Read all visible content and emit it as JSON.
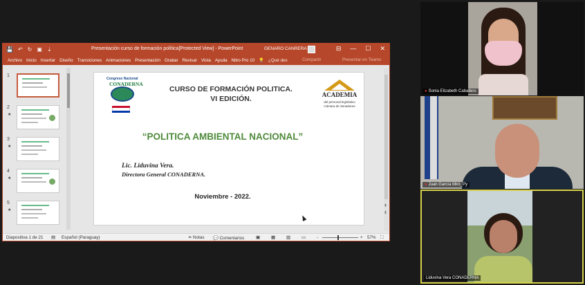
{
  "powerpoint": {
    "window_title": "Presentación curso de formación política[Protected View]  -  PowerPoint",
    "user_name": "GENARO CANRERA",
    "quick_access": [
      "💾",
      "↶",
      "↻",
      "▣",
      "⇣"
    ],
    "window_controls": {
      "ribbon_display": "⊟",
      "minimize": "—",
      "maximize": "☐",
      "close": "✕"
    },
    "ribbon_tabs": [
      "Archivo",
      "Inicio",
      "Insertar",
      "Diseño",
      "Transiciones",
      "Animaciones",
      "Presentación",
      "Grabar",
      "Revisar",
      "Vista",
      "Ayuda",
      "Nitro Pro 10"
    ],
    "tell_me": "¿Qué des",
    "share": "Compartir",
    "present_teams": "Presentar en Teams",
    "thumbnails": [
      {
        "num": "1",
        "star": ""
      },
      {
        "num": "2",
        "star": "★"
      },
      {
        "num": "3",
        "star": "★"
      },
      {
        "num": "4",
        "star": "★"
      },
      {
        "num": "5",
        "star": "★"
      }
    ],
    "slide": {
      "logo_left_line1": "Congreso Nacional",
      "logo_left_line2": "CONADERNA",
      "title_line1": "CURSO DE FORMACIÓN POLITICA.",
      "title_line2": "VI EDICIÓN.",
      "logo_right_name": "ACADEMIA",
      "logo_right_sub1": "del personal legislativo",
      "logo_right_sub2": "Cámara de Senadores",
      "main_title": "“POLITICA AMBIENTAL NACIONAL”",
      "author": "Lic. Liduvina Vera.",
      "role": "Directora General CONADERNA.",
      "date": "Noviembre - 2022."
    },
    "status": {
      "slide_count": "Diapositiva 1 de 21",
      "language": "Español (Paraguay)",
      "notes": "≐ Notas",
      "comments": "💬 Comentarios",
      "zoom_minus": "-",
      "zoom_plus": "+",
      "zoom": "57%"
    }
  },
  "participants": [
    {
      "name": "Sonia Elizabeth Caballero"
    },
    {
      "name": "Juan García Miró_Py"
    },
    {
      "name": "Liduvina Vera CONADERNA"
    }
  ],
  "colors": {
    "ppt_accent": "#b7472a",
    "active_speaker": "#d8d24a",
    "slide_green": "#4e8a3a"
  }
}
